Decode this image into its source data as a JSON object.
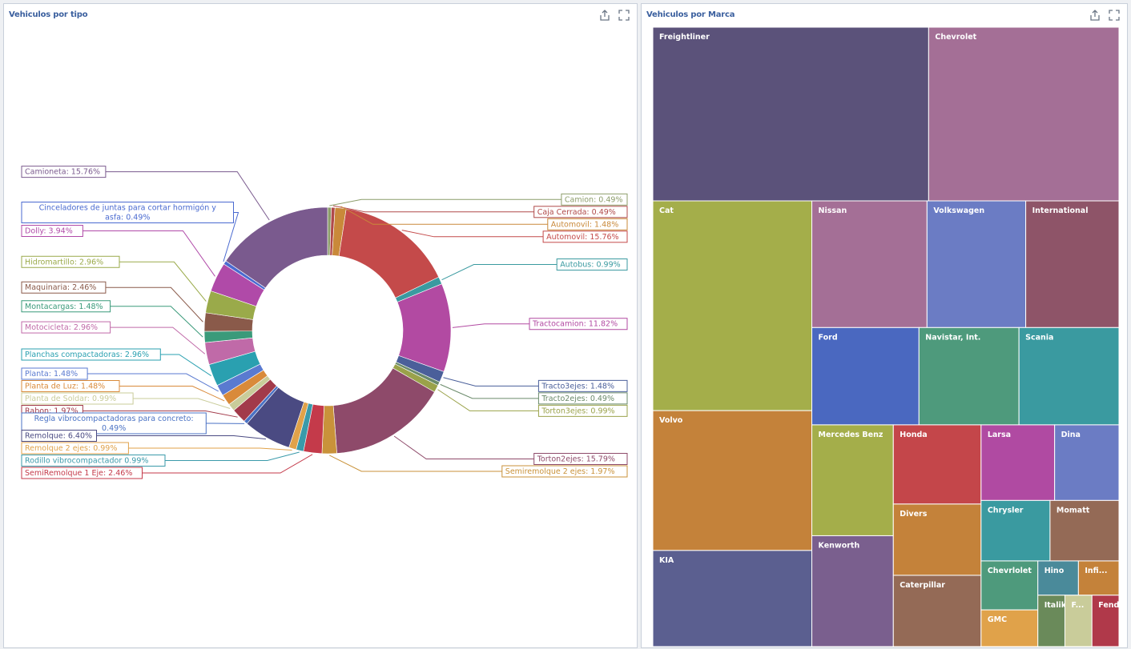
{
  "panels": {
    "left": {
      "title": "Vehiculos por tipo",
      "icons": [
        "export-icon",
        "fullscreen-icon"
      ]
    },
    "right": {
      "title": "Vehiculos por Marca",
      "icons": [
        "export-icon",
        "fullscreen-icon"
      ]
    }
  },
  "chart_data": [
    {
      "type": "pie",
      "title": "Vehiculos por tipo",
      "donut": true,
      "slices": [
        {
          "label": "Camion: 0.49%",
          "value": 0.49,
          "color": "#8c9d6a"
        },
        {
          "label": "Caja Cerrada: 0.49%",
          "value": 0.49,
          "color": "#b04a4a"
        },
        {
          "label": "Automovil: 1.48%",
          "value": 1.48,
          "color": "#c9893a"
        },
        {
          "label": "Automovil: 15.76%",
          "value": 15.76,
          "color": "#c44a4a"
        },
        {
          "label": "Autobus: 0.99%",
          "value": 0.99,
          "color": "#3a9aa0"
        },
        {
          "label": "Tractocamion: 11.82%",
          "value": 11.82,
          "color": "#b24aa2"
        },
        {
          "label": "Tracto3ejes: 1.48%",
          "value": 1.48,
          "color": "#4a5f9a"
        },
        {
          "label": "Tracto2ejes: 0.49%",
          "value": 0.49,
          "color": "#6a8a6a"
        },
        {
          "label": "Torton3ejes: 0.99%",
          "value": 0.99,
          "color": "#9aa24a"
        },
        {
          "label": "Torton2ejes: 15.79%",
          "value": 15.79,
          "color": "#8e4a6a"
        },
        {
          "label": "Semiremolque 2 ejes: 1.97%",
          "value": 1.97,
          "color": "#c9923a"
        },
        {
          "label": "SemiRemolque 1 Eje: 2.46%",
          "value": 2.46,
          "color": "#c43a4a"
        },
        {
          "label": "Rodillo vibrocompactador 0.99%",
          "value": 0.99,
          "color": "#3a9aaa"
        },
        {
          "label": "Remolque 2 ejes: 0.99%",
          "value": 0.99,
          "color": "#e0a24a"
        },
        {
          "label": "Remolque: 6.40%",
          "value": 6.4,
          "color": "#4a4a82"
        },
        {
          "label": "Regla vibrocompactadoras para concreto: 0.49%",
          "value": 0.49,
          "color": "#4a72c4"
        },
        {
          "label": "Rabon: 1.97%",
          "value": 1.97,
          "color": "#a23a4a"
        },
        {
          "label": "Planta de Soldar: 0.99%",
          "value": 0.99,
          "color": "#c9cc9a"
        },
        {
          "label": "Planta de Luz: 1.48%",
          "value": 1.48,
          "color": "#d98a3a"
        },
        {
          "label": "Planta: 1.48%",
          "value": 1.48,
          "color": "#5a7ad0"
        },
        {
          "label": "Planchas compactadoras: 2.96%",
          "value": 2.96,
          "color": "#2aa0b0"
        },
        {
          "label": "Motocicleta: 2.96%",
          "value": 2.96,
          "color": "#c06aa8"
        },
        {
          "label": "Montacargas: 1.48%",
          "value": 1.48,
          "color": "#3a9a7a"
        },
        {
          "label": "Maquinaria: 2.46%",
          "value": 2.46,
          "color": "#8a5a4a"
        },
        {
          "label": "Hidromartillo: 2.96%",
          "value": 2.96,
          "color": "#9aaa4a"
        },
        {
          "label": "Dolly: 3.94%",
          "value": 3.94,
          "color": "#b04aa8"
        },
        {
          "label": "Cinceladores de juntas para cortar hormigón y asfa: 0.49%",
          "value": 0.49,
          "color": "#4a6ad0"
        },
        {
          "label": "Camioneta: 15.76%",
          "value": 15.76,
          "color": "#7a5a8e"
        }
      ]
    },
    {
      "type": "treemap",
      "title": "Vehiculos por Marca",
      "items": [
        {
          "label": "Freightliner",
          "value": 100,
          "color": "#5b527a"
        },
        {
          "label": "Chevrolet",
          "value": 69,
          "color": "#a46f96"
        },
        {
          "label": "Cat",
          "value": 48,
          "color": "#a4ae4a"
        },
        {
          "label": "Volkswagen",
          "value": 18,
          "color": "#6b7cc4"
        },
        {
          "label": "International",
          "value": 17,
          "color": "#8e5468"
        },
        {
          "label": "Nissan",
          "value": 21,
          "color": "#a46f96"
        },
        {
          "label": "Ford",
          "value": 15,
          "color": "#4a68c0"
        },
        {
          "label": "Mercedes Benz",
          "value": 13,
          "color": "#a4ae4a"
        },
        {
          "label": "Kenworth",
          "value": 13,
          "color": "#7a5f8e"
        },
        {
          "label": "Volvo",
          "value": 32,
          "color": "#c4823a"
        },
        {
          "label": "Navistar, Int.",
          "value": 14,
          "color": "#4e9a7c"
        },
        {
          "label": "Honda",
          "value": 10,
          "color": "#c4464a"
        },
        {
          "label": "Divers",
          "value": 9,
          "color": "#c4823a"
        },
        {
          "label": "Dina",
          "value": 7,
          "color": "#6b7cc4"
        },
        {
          "label": "Chrysler",
          "value": 6,
          "color": "#3a9aa0"
        },
        {
          "label": "Momatt",
          "value": 6,
          "color": "#946a56"
        },
        {
          "label": "Caterpillar",
          "value": 9,
          "color": "#946a56"
        },
        {
          "label": "Scania",
          "value": 14,
          "color": "#3a9aa0"
        },
        {
          "label": "Chevrlolet",
          "value": 4,
          "color": "#4e9a7c"
        },
        {
          "label": "Hino",
          "value": 2,
          "color": "#4a8a9a"
        },
        {
          "label": "Infi...",
          "value": 2,
          "color": "#c4823a"
        },
        {
          "label": "KIA",
          "value": 22,
          "color": "#5b5f90"
        },
        {
          "label": "Larsa",
          "value": 8,
          "color": "#b04aa2"
        },
        {
          "label": "Italika",
          "value": 2,
          "color": "#6a8a5a"
        },
        {
          "label": "F...",
          "value": 2,
          "color": "#c9cc9a"
        },
        {
          "label": "GMC",
          "value": 3,
          "color": "#e0a24a"
        },
        {
          "label": "Fendt",
          "value": 2,
          "color": "#b0394a"
        }
      ]
    }
  ]
}
